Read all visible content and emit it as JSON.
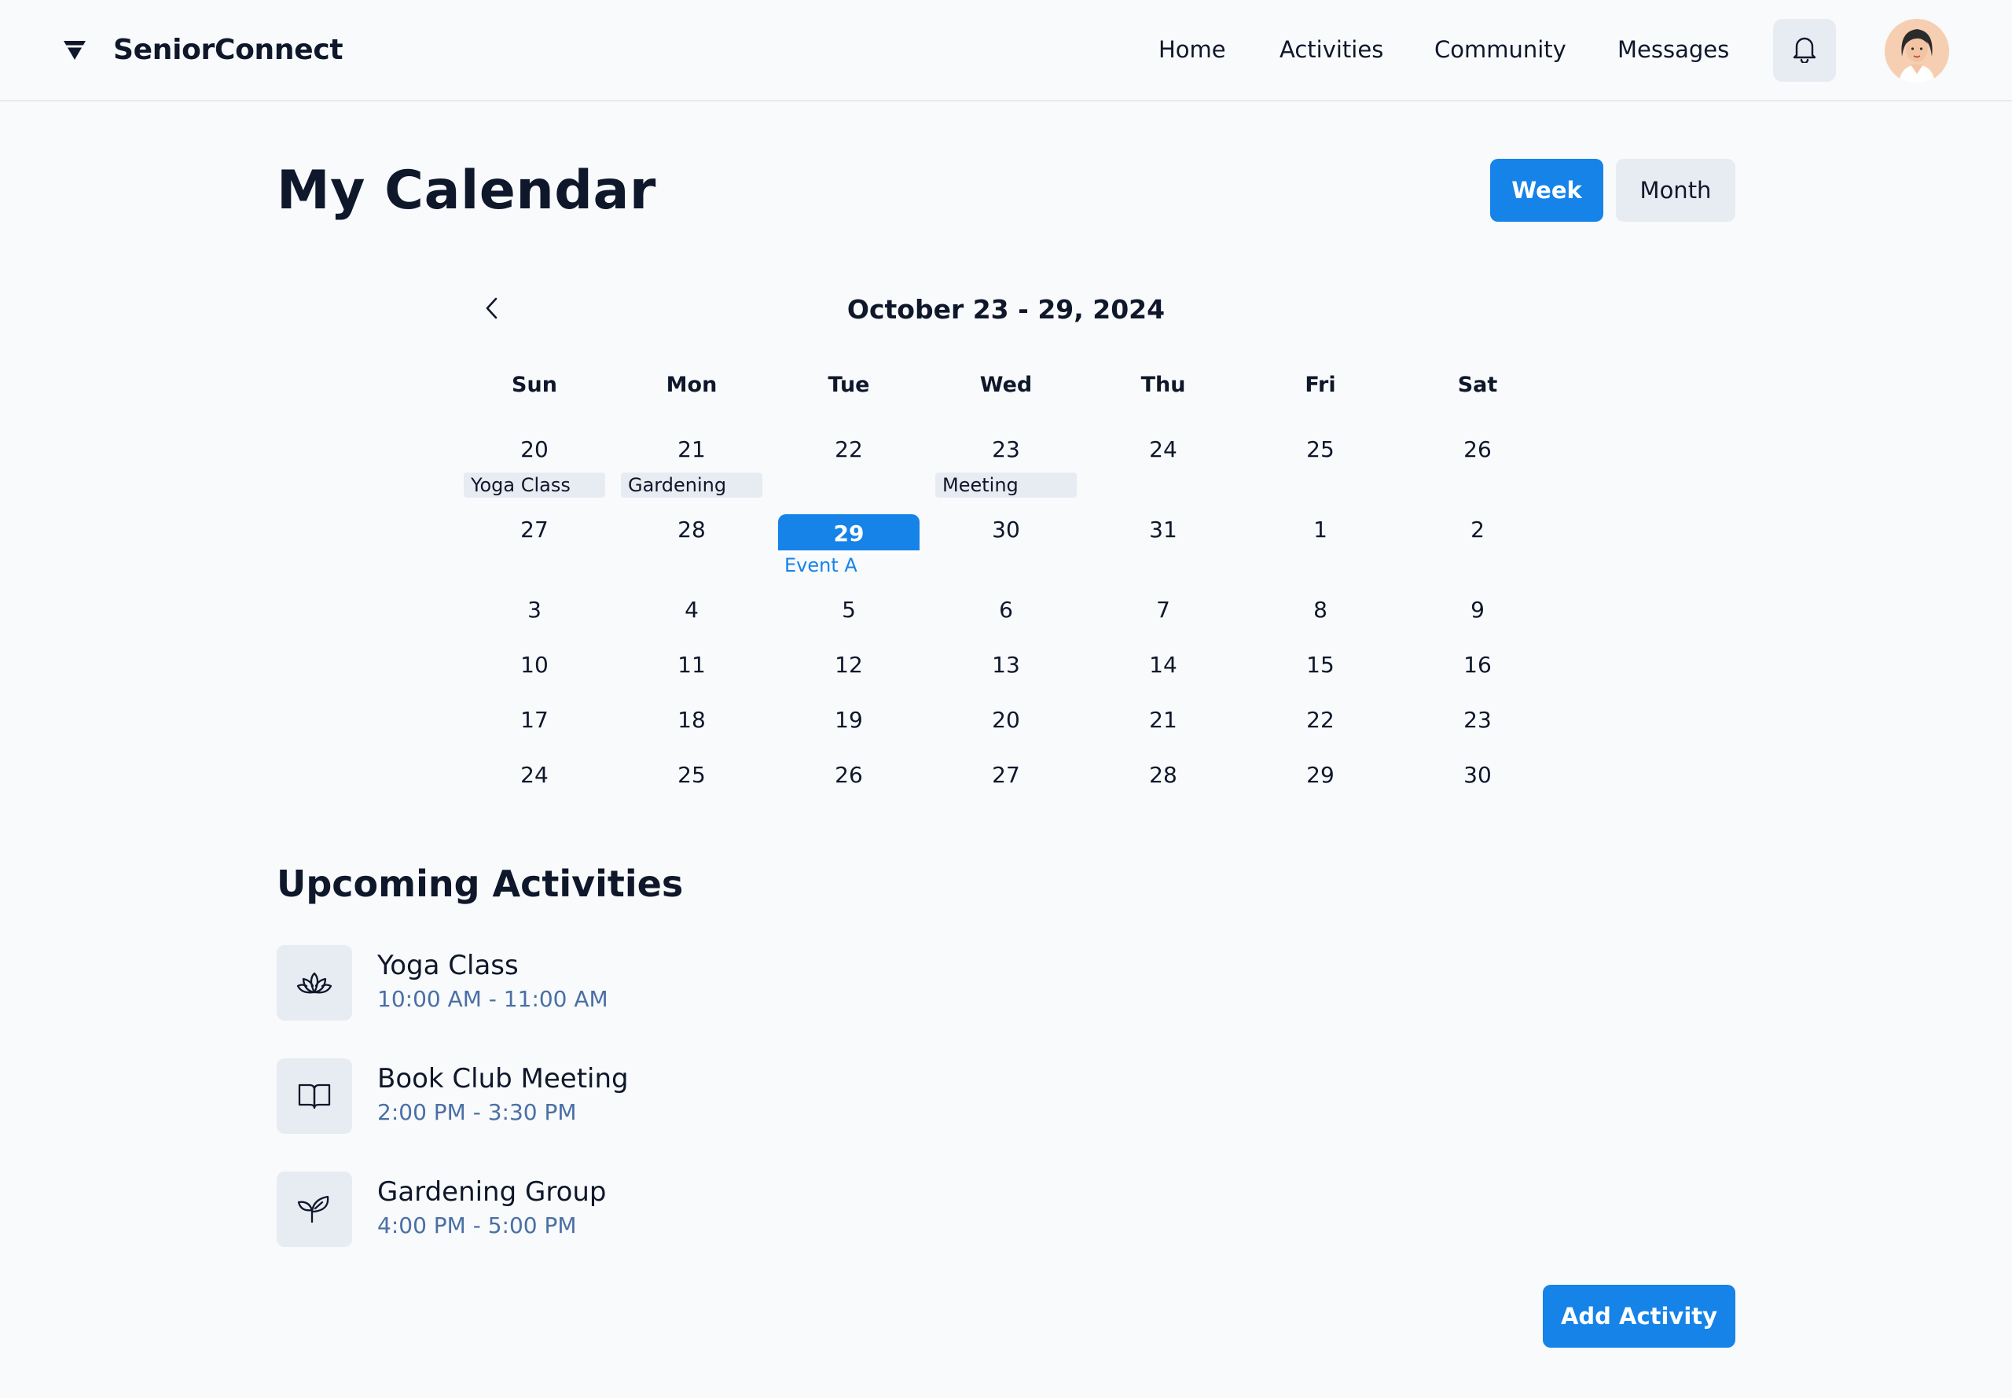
{
  "header": {
    "brand": "SeniorConnect",
    "nav": [
      "Home",
      "Activities",
      "Community",
      "Messages"
    ]
  },
  "page": {
    "title": "My Calendar",
    "view_toggle": {
      "week": "Week",
      "month": "Month",
      "active": "Week"
    }
  },
  "calendar": {
    "range": "October 23 - 29, 2024",
    "weekdays": [
      "Sun",
      "Mon",
      "Tue",
      "Wed",
      "Thu",
      "Fri",
      "Sat"
    ],
    "weeks": [
      [
        "20",
        "21",
        "22",
        "23",
        "24",
        "25",
        "26"
      ],
      [
        "27",
        "28",
        "29",
        "30",
        "31",
        "1",
        "2"
      ],
      [
        "3",
        "4",
        "5",
        "6",
        "7",
        "8",
        "9"
      ],
      [
        "10",
        "11",
        "12",
        "13",
        "14",
        "15",
        "16"
      ],
      [
        "17",
        "18",
        "19",
        "20",
        "21",
        "22",
        "23"
      ],
      [
        "24",
        "25",
        "26",
        "27",
        "28",
        "29",
        "30"
      ]
    ],
    "selected_day": "29",
    "events": {
      "sun_20": "Yoga Class",
      "mon_21": "Gardening",
      "wed_23": "Meeting",
      "tue_29": "Event A"
    }
  },
  "upcoming": {
    "title": "Upcoming Activities",
    "items": [
      {
        "name": "Yoga Class",
        "time": "10:00 AM - 11:00 AM",
        "icon": "lotus-icon"
      },
      {
        "name": "Book Club Meeting",
        "time": "2:00 PM - 3:30 PM",
        "icon": "book-icon"
      },
      {
        "name": "Gardening Group",
        "time": "4:00 PM - 5:00 PM",
        "icon": "sprout-icon"
      }
    ]
  },
  "actions": {
    "add": "Add Activity"
  },
  "colors": {
    "accent": "#1583e8",
    "chip": "#e7ecf3",
    "time_text": "#4a6fa5",
    "background": "#f8fafc"
  }
}
